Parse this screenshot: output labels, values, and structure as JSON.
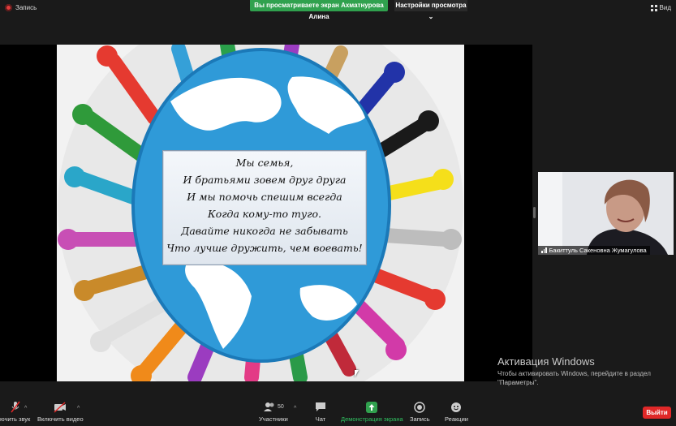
{
  "topbar": {
    "recording_label": "Запись",
    "sharing_banner": "Вы просматриваете экран Ахматнурова Алина",
    "view_options_label": "Настройки просмотра",
    "view_label": "Вид"
  },
  "slide": {
    "poem_lines": [
      "Мы семья,",
      "И братьями зовем друг друга",
      "И мы помочь спешим всегда",
      "Когда кому-то туго.",
      "Давайте никогда не забывать",
      "Что лучше дружить, чем воевать!"
    ]
  },
  "participant": {
    "name": "Бакиттуль Сакеновна Жумагулова"
  },
  "watermark": {
    "title": "Активация Windows",
    "line1": "Чтобы активировать Windows, перейдите в раздел",
    "line2": "\"Параметры\"."
  },
  "toolbar": {
    "audio_label": "ючить звук",
    "video_label": "Включить видео",
    "participants_label": "Участники",
    "participants_count": "50",
    "chat_label": "Чат",
    "share_label": "Демонстрация экрана",
    "record_label": "Запись",
    "reactions_label": "Реакции",
    "leave_label": "Выйти"
  },
  "colors": {
    "share_green": "#30a14e",
    "leave_red": "#e02828",
    "globe_blue": "#2f9ad8"
  }
}
